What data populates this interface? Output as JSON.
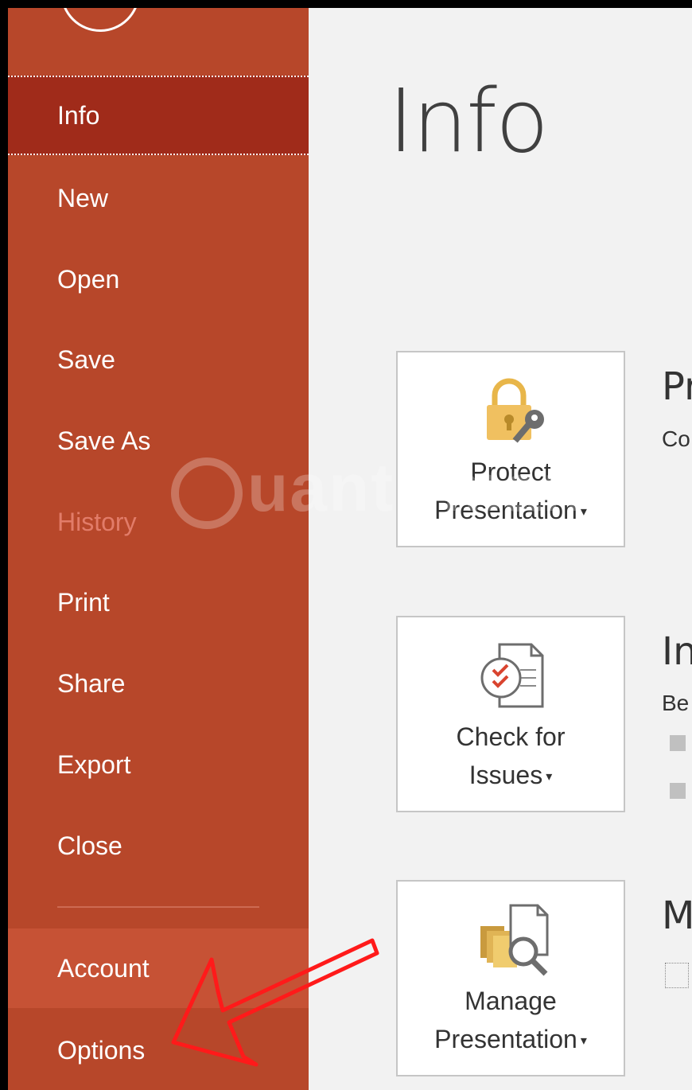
{
  "sidebar": {
    "items": [
      {
        "label": "Info"
      },
      {
        "label": "New"
      },
      {
        "label": "Open"
      },
      {
        "label": "Save"
      },
      {
        "label": "Save As"
      },
      {
        "label": "History"
      },
      {
        "label": "Print"
      },
      {
        "label": "Share"
      },
      {
        "label": "Export"
      },
      {
        "label": "Close"
      },
      {
        "label": "Account"
      },
      {
        "label": "Options"
      }
    ]
  },
  "main": {
    "title": "Info",
    "buttons": [
      {
        "line1": "Protect",
        "line2": "Presentation"
      },
      {
        "line1": "Check for",
        "line2": "Issues"
      },
      {
        "line1": "Manage",
        "line2": "Presentation"
      }
    ],
    "sections": [
      {
        "title": "Pr",
        "desc": "Co"
      },
      {
        "title": "In",
        "desc": "Be"
      },
      {
        "title": "M"
      }
    ]
  },
  "watermark": {
    "text": "uantrimang"
  },
  "colors": {
    "sidebar": "#b7472a",
    "selected": "#a02b1a",
    "disabled": "#e27c69",
    "annotation_arrow": "#ff1a1a"
  },
  "icons": [
    "back-arrow-icon",
    "lock-key-icon",
    "checklist-icon",
    "manage-docs-icon",
    "annotation-arrow"
  ]
}
